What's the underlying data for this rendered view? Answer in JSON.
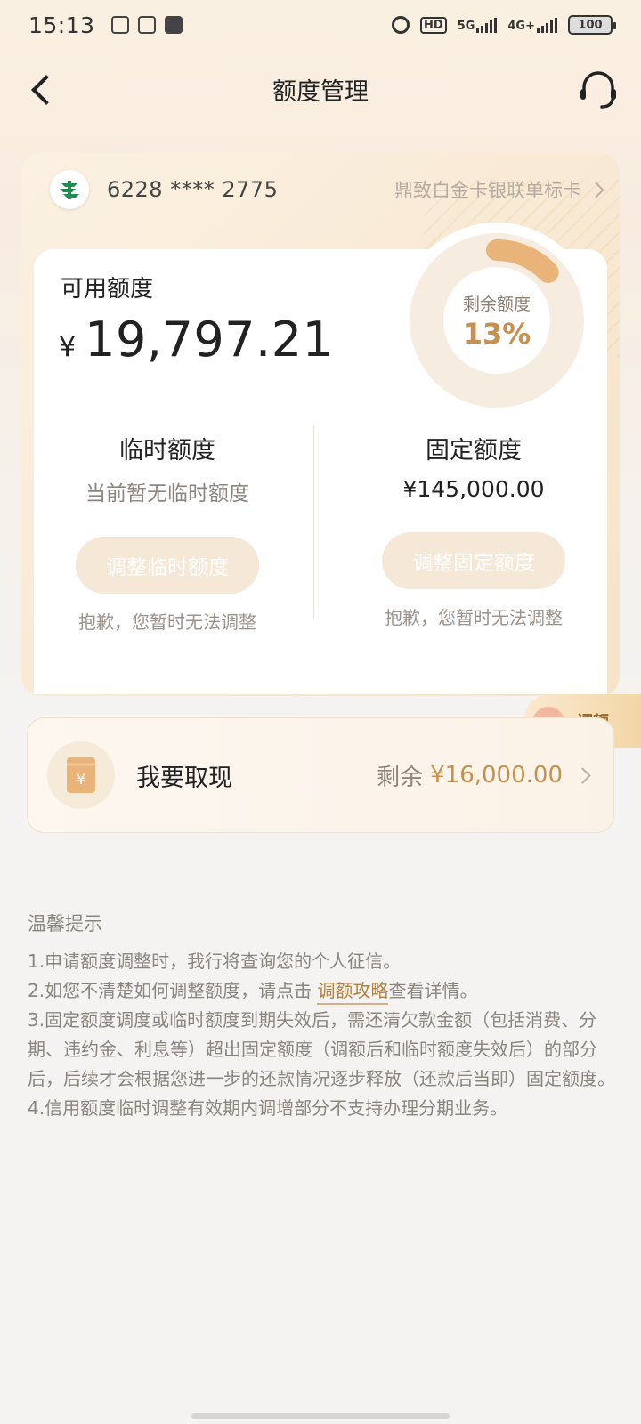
{
  "status": {
    "time": "15:13",
    "network": "5G",
    "network2": "4G+",
    "battery": "100"
  },
  "nav": {
    "title": "额度管理"
  },
  "card": {
    "number": "6228 **** 2775",
    "type": "鼎致白金卡银联单标卡",
    "available_label": "可用额度",
    "currency_symbol": "¥",
    "available_amount": "19,797.21",
    "remaining_label": "剩余额度",
    "remaining_percent": "13%",
    "remaining_fraction": 0.13,
    "temporary": {
      "title": "临时额度",
      "subtitle": "当前暂无临时额度",
      "button": "调整临时额度",
      "note": "抱歉，您暂时无法调整"
    },
    "fixed": {
      "title": "固定额度",
      "amount": "¥145,000.00",
      "button": "调整固定额度",
      "note": "抱歉，您暂时无法调整"
    }
  },
  "float_tag": {
    "label": "调额"
  },
  "withdraw": {
    "label": "我要取现",
    "remaining_prefix": "剩余",
    "remaining_amount": "¥16,000.00"
  },
  "tips": {
    "title": "温馨提示",
    "item1": "1.申请额度调整时，我行将查询您的个人征信。",
    "item2_prefix": "2.如您不清楚如何调整额度，请点击 ",
    "item2_link": "调额攻略",
    "item2_suffix": "查看详情。",
    "item3": "3.固定额度调度或临时额度到期失效后，需还清欠款金额（包括消费、分期、违约金、利息等）超出固定额度（调额后和临时额度失效后）的部分后，后续才会根据您进一步的还款情况逐步释放（还款后当即）固定额度。",
    "item4": "4.信用额度临时调整有效期内调增部分不支持办理分期业务。"
  },
  "colors": {
    "accent_gold": "#c69050",
    "ring_track": "#f6ece0",
    "button_disabled_bg": "#f5e8d7"
  }
}
